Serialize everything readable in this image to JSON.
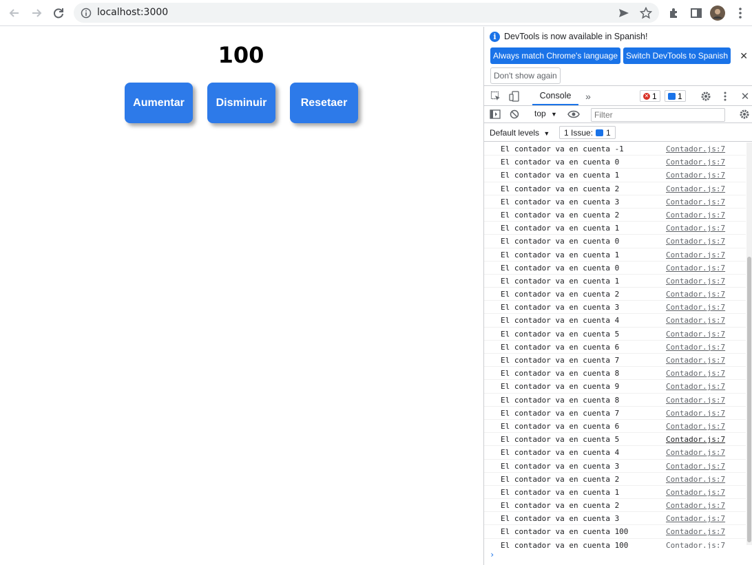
{
  "browser": {
    "url": "localhost:3000"
  },
  "app": {
    "counter": "100",
    "buttons": {
      "increase": "Aumentar",
      "decrease": "Disminuir",
      "reset": "Resetaer"
    }
  },
  "devtools": {
    "infobar": {
      "message": "DevTools is now available in Spanish!",
      "match_btn": "Always match Chrome's language",
      "switch_btn": "Switch DevTools to Spanish",
      "dont_show": "Don't show again"
    },
    "tabs": {
      "console": "Console"
    },
    "badges": {
      "errors": "1",
      "messages": "1"
    },
    "console_toolbar": {
      "context": "top",
      "filter_placeholder": "Filter"
    },
    "levels": {
      "label": "Default levels",
      "issues_label": "1 Issue:",
      "issues_count": "1"
    },
    "logs": [
      {
        "msg": "El contador va en cuenta -1",
        "src": "Contador.js:7"
      },
      {
        "msg": "El contador va en cuenta 0",
        "src": "Contador.js:7"
      },
      {
        "msg": "El contador va en cuenta 1",
        "src": "Contador.js:7"
      },
      {
        "msg": "El contador va en cuenta 2",
        "src": "Contador.js:7"
      },
      {
        "msg": "El contador va en cuenta 3",
        "src": "Contador.js:7"
      },
      {
        "msg": "El contador va en cuenta 2",
        "src": "Contador.js:7"
      },
      {
        "msg": "El contador va en cuenta 1",
        "src": "Contador.js:7"
      },
      {
        "msg": "El contador va en cuenta 0",
        "src": "Contador.js:7"
      },
      {
        "msg": "El contador va en cuenta 1",
        "src": "Contador.js:7"
      },
      {
        "msg": "El contador va en cuenta 0",
        "src": "Contador.js:7"
      },
      {
        "msg": "El contador va en cuenta 1",
        "src": "Contador.js:7"
      },
      {
        "msg": "El contador va en cuenta 2",
        "src": "Contador.js:7"
      },
      {
        "msg": "El contador va en cuenta 3",
        "src": "Contador.js:7"
      },
      {
        "msg": "El contador va en cuenta 4",
        "src": "Contador.js:7"
      },
      {
        "msg": "El contador va en cuenta 5",
        "src": "Contador.js:7"
      },
      {
        "msg": "El contador va en cuenta 6",
        "src": "Contador.js:7"
      },
      {
        "msg": "El contador va en cuenta 7",
        "src": "Contador.js:7"
      },
      {
        "msg": "El contador va en cuenta 8",
        "src": "Contador.js:7"
      },
      {
        "msg": "El contador va en cuenta 9",
        "src": "Contador.js:7"
      },
      {
        "msg": "El contador va en cuenta 8",
        "src": "Contador.js:7"
      },
      {
        "msg": "El contador va en cuenta 7",
        "src": "Contador.js:7"
      },
      {
        "msg": "El contador va en cuenta 6",
        "src": "Contador.js:7"
      },
      {
        "msg": "El contador va en cuenta 5",
        "src": "Contador.js:7"
      },
      {
        "msg": "El contador va en cuenta 4",
        "src": "Contador.js:7"
      },
      {
        "msg": "El contador va en cuenta 3",
        "src": "Contador.js:7"
      },
      {
        "msg": "El contador va en cuenta 2",
        "src": "Contador.js:7"
      },
      {
        "msg": "El contador va en cuenta 1",
        "src": "Contador.js:7"
      },
      {
        "msg": "El contador va en cuenta 2",
        "src": "Contador.js:7"
      },
      {
        "msg": "El contador va en cuenta 3",
        "src": "Contador.js:7"
      },
      {
        "msg": "El contador va en cuenta 100",
        "src": "Contador.js:7"
      },
      {
        "msg": "El contador va en cuenta 100",
        "src": "Contador.js:7"
      }
    ],
    "prompt": "›"
  },
  "colors": {
    "accent": "#1a73e8",
    "app_button": "#2d7ae9",
    "error": "#d93025"
  }
}
